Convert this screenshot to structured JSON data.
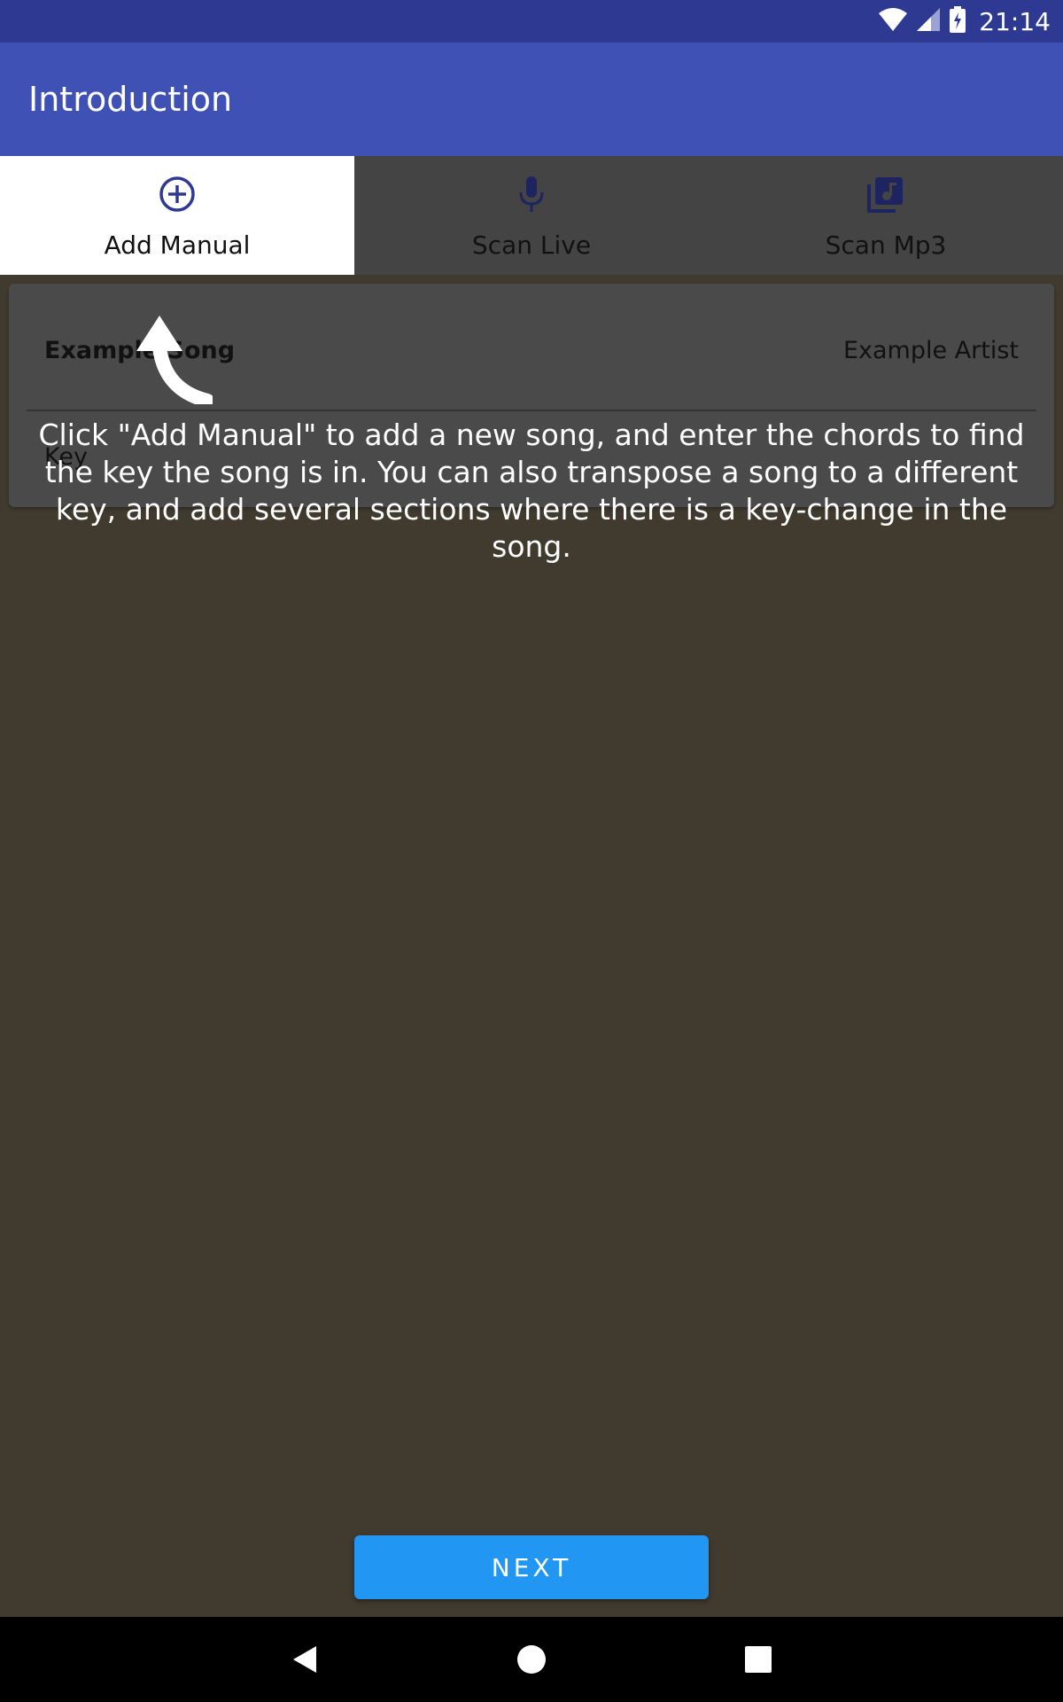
{
  "status_bar": {
    "time": "21:14",
    "icons": [
      "wifi-icon",
      "cell-signal-icon",
      "battery-charging-icon"
    ]
  },
  "app_bar": {
    "title": "Introduction"
  },
  "tabs": [
    {
      "label": "Add Manual",
      "icon": "add-circle-icon",
      "active": true
    },
    {
      "label": "Scan Live",
      "icon": "microphone-icon",
      "active": false
    },
    {
      "label": "Scan Mp3",
      "icon": "music-library-icon",
      "active": false
    }
  ],
  "song_card": {
    "title": "Example Song",
    "artist": "Example Artist",
    "key_label": "Key"
  },
  "tutorial": {
    "hint": "Click \"Add Manual\" to add a new song, and enter the chords to find the key the song is in.  You can also transpose a song to a different key, and add several sections where there is a key-change in the song."
  },
  "next_button": {
    "label": "NEXT"
  },
  "nav_bar": {
    "buttons": [
      "back-icon",
      "home-icon",
      "recents-icon"
    ]
  },
  "colors": {
    "status_bar": "#2e3a91",
    "app_bar": "#3f51b5",
    "accent": "#2196f3",
    "overlay": "#403a2f"
  }
}
